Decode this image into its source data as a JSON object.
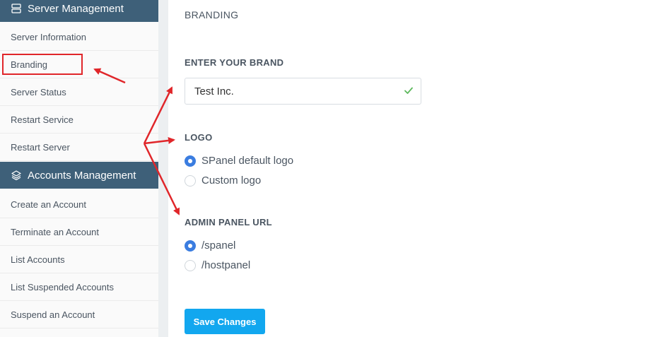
{
  "sidebar": {
    "server_section": {
      "title": "Server Management",
      "icon": "server-icon"
    },
    "server_items": [
      {
        "label": "Server Information"
      },
      {
        "label": "Branding"
      },
      {
        "label": "Server Status"
      },
      {
        "label": "Restart Service"
      },
      {
        "label": "Restart Server"
      }
    ],
    "accounts_section": {
      "title": "Accounts Management",
      "icon": "layers-icon"
    },
    "accounts_items": [
      {
        "label": "Create an Account"
      },
      {
        "label": "Terminate an Account"
      },
      {
        "label": "List Accounts"
      },
      {
        "label": "List Suspended Accounts"
      },
      {
        "label": "Suspend an Account"
      }
    ]
  },
  "main": {
    "page_title": "BRANDING",
    "brand": {
      "label": "ENTER YOUR BRAND",
      "value": "Test Inc."
    },
    "logo": {
      "label": "LOGO",
      "options": [
        {
          "label": "SPanel default logo",
          "selected": true
        },
        {
          "label": "Custom logo",
          "selected": false
        }
      ]
    },
    "admin_url": {
      "label": "ADMIN PANEL URL",
      "options": [
        {
          "label": "/spanel",
          "selected": true
        },
        {
          "label": "/hostpanel",
          "selected": false
        }
      ]
    },
    "save_label": "Save Changes"
  },
  "colors": {
    "sidebar_header": "#3e6079",
    "accent_blue": "#3b7de0",
    "button": "#12a7ef",
    "annotation_red": "#e0262a",
    "check_green": "#5cb85c"
  }
}
